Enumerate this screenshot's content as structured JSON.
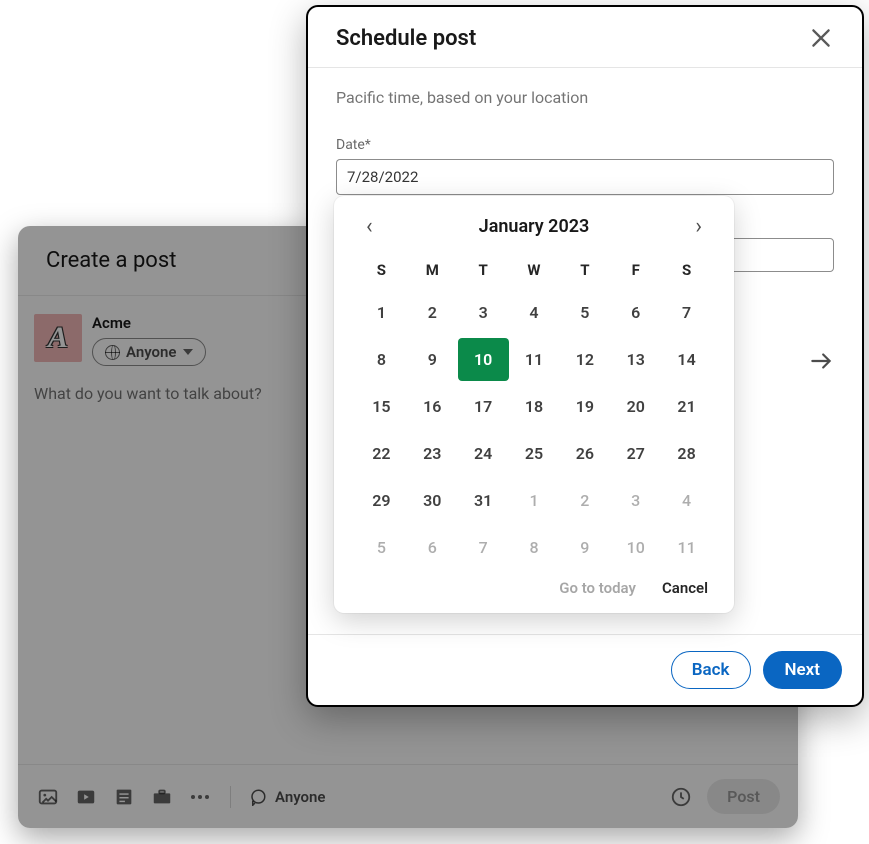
{
  "create_post": {
    "title": "Create a post",
    "author_name": "Acme",
    "avatar_letter": "A",
    "visibility_label": "Anyone",
    "placeholder": "What do you want to talk about?",
    "footer": {
      "comment_label": "Anyone",
      "post_button": "Post"
    }
  },
  "schedule": {
    "title": "Schedule post",
    "tz_note": "Pacific time, based on your location",
    "date_label": "Date*",
    "date_value": "7/28/2022",
    "back_button": "Back",
    "next_button": "Next"
  },
  "datepicker": {
    "month_label": "January 2023",
    "prev_glyph": "‹",
    "next_glyph": "›",
    "dow": [
      "S",
      "M",
      "T",
      "W",
      "T",
      "F",
      "S"
    ],
    "weeks": [
      [
        {
          "n": "1"
        },
        {
          "n": "2"
        },
        {
          "n": "3"
        },
        {
          "n": "4"
        },
        {
          "n": "5"
        },
        {
          "n": "6"
        },
        {
          "n": "7"
        }
      ],
      [
        {
          "n": "8"
        },
        {
          "n": "9"
        },
        {
          "n": "10",
          "sel": true
        },
        {
          "n": "11"
        },
        {
          "n": "12"
        },
        {
          "n": "13"
        },
        {
          "n": "14"
        }
      ],
      [
        {
          "n": "15"
        },
        {
          "n": "16"
        },
        {
          "n": "17"
        },
        {
          "n": "18"
        },
        {
          "n": "19"
        },
        {
          "n": "20"
        },
        {
          "n": "21"
        }
      ],
      [
        {
          "n": "22"
        },
        {
          "n": "23"
        },
        {
          "n": "24"
        },
        {
          "n": "25"
        },
        {
          "n": "26"
        },
        {
          "n": "27"
        },
        {
          "n": "28"
        }
      ],
      [
        {
          "n": "29"
        },
        {
          "n": "30"
        },
        {
          "n": "31"
        },
        {
          "n": "1",
          "other": true
        },
        {
          "n": "2",
          "other": true
        },
        {
          "n": "3",
          "other": true
        },
        {
          "n": "4",
          "other": true
        }
      ],
      [
        {
          "n": "5",
          "other": true
        },
        {
          "n": "6",
          "other": true
        },
        {
          "n": "7",
          "other": true
        },
        {
          "n": "8",
          "other": true
        },
        {
          "n": "9",
          "other": true
        },
        {
          "n": "10",
          "other": true
        },
        {
          "n": "11",
          "other": true
        }
      ]
    ],
    "go_today": "Go to today",
    "cancel": "Cancel"
  }
}
